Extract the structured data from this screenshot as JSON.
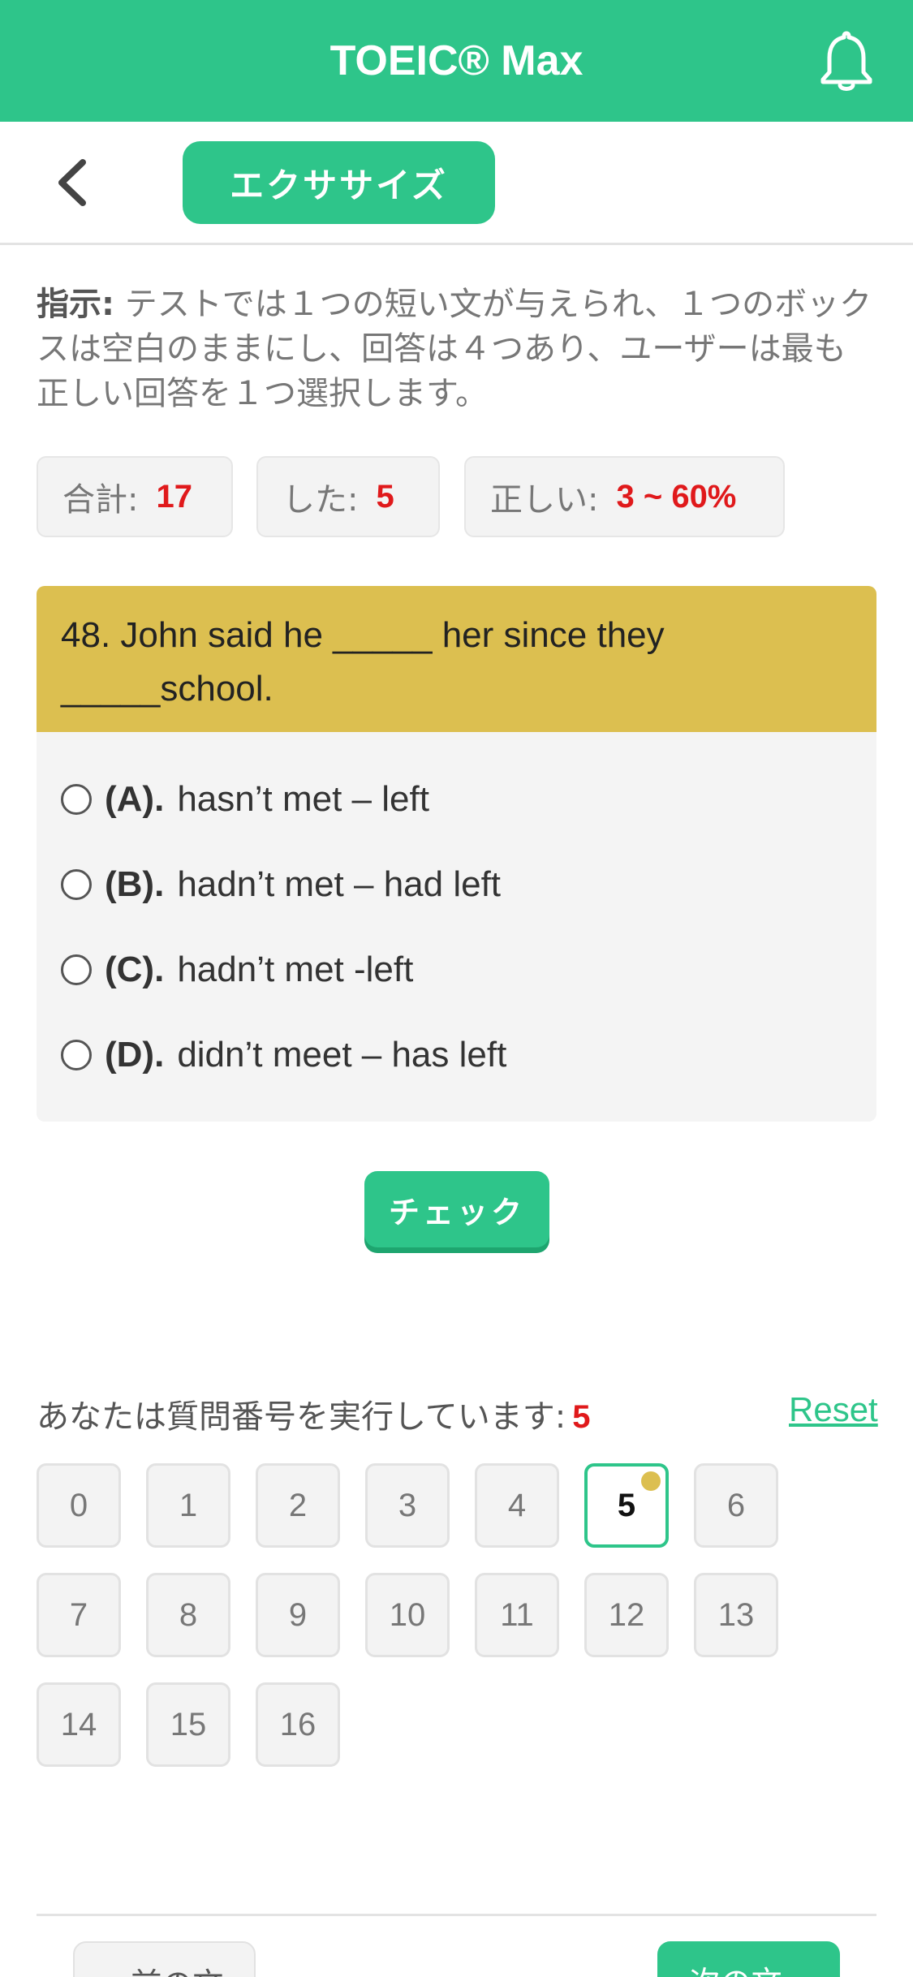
{
  "app": {
    "title": "TOEIC® Max"
  },
  "subbar": {
    "exercise_label": "エクササイズ"
  },
  "instructions": {
    "label": "指示:",
    "text": " テストでは１つの短い文が与えられ、１つのボックスは空白のままにし、回答は４つあり、ユーザーは最も正しい回答を１つ選択します。"
  },
  "stats": {
    "total_label": "合計:",
    "total_value": "17",
    "done_label": "した:",
    "done_value": "5",
    "correct_label": "正しい:",
    "correct_value": "3 ~ 60%"
  },
  "question": {
    "text": "48. John said he _____ her since they _____school.",
    "options": [
      {
        "letter": "(A).",
        "text": "hasn’t met – left"
      },
      {
        "letter": "(B).",
        "text": "hadn’t met – had left"
      },
      {
        "letter": "(C).",
        "text": "hadn’t met -left"
      },
      {
        "letter": "(D).",
        "text": "didn’t meet – has left"
      }
    ]
  },
  "check_label": "チェック",
  "progress": {
    "running_label": "あなたは質問番号を実行しています:",
    "current": "5",
    "reset_label": "Reset",
    "numbers": [
      "0",
      "1",
      "2",
      "3",
      "4",
      "5",
      "6",
      "7",
      "8",
      "9",
      "10",
      "11",
      "12",
      "13",
      "14",
      "15",
      "16"
    ]
  },
  "nav": {
    "prev_label": "« 前の文",
    "next_label": "次の文 »"
  },
  "colors": {
    "brand": "#2ec58a",
    "question_bg": "#dcbf50",
    "highlight": "#e0191b"
  }
}
